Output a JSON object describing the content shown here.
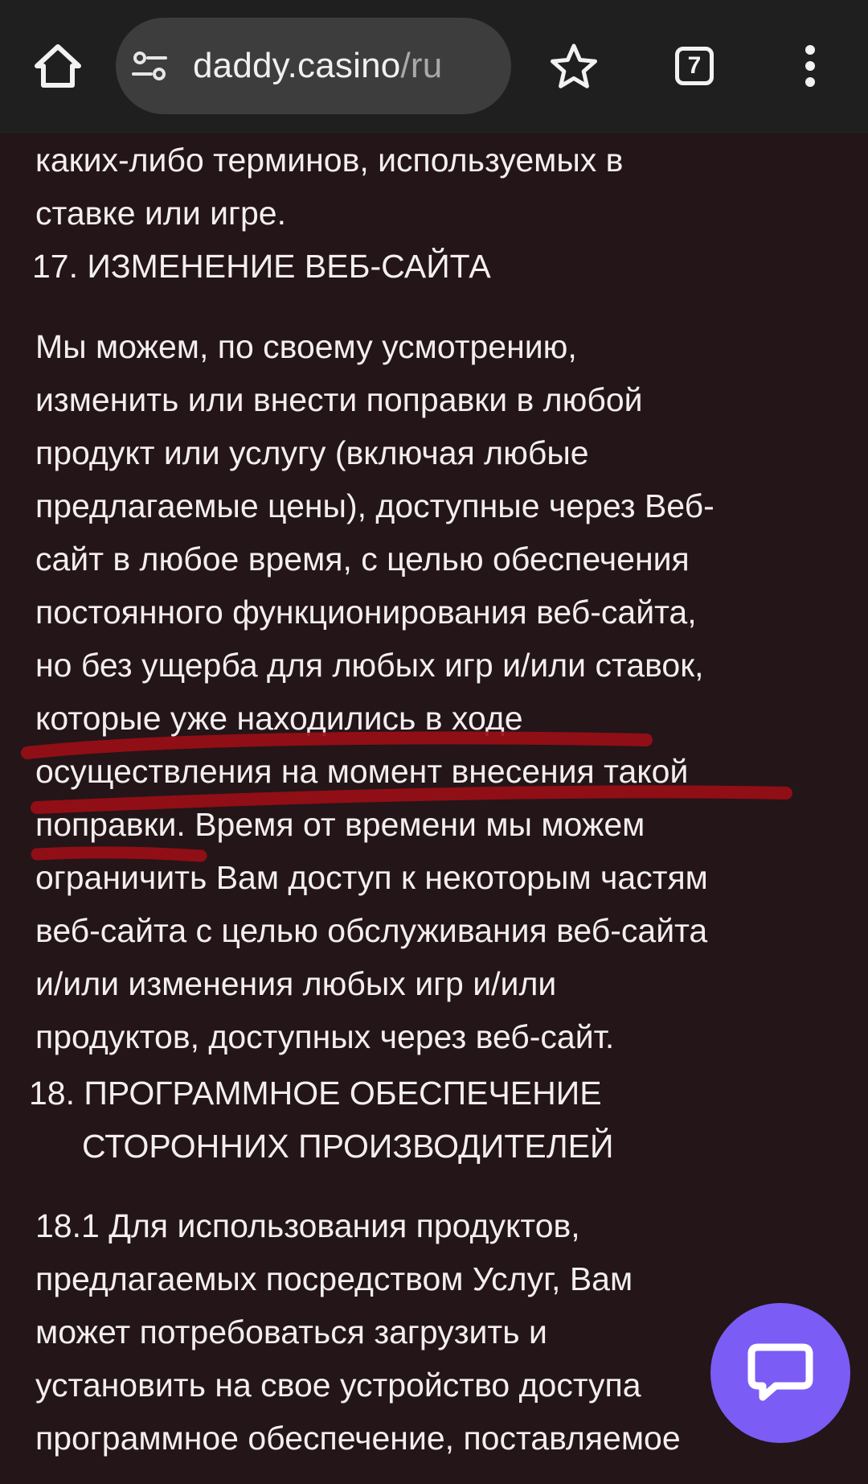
{
  "browser": {
    "url_host": "daddy.casino",
    "url_path": "/ru",
    "tab_count": "7",
    "icons": {
      "home": "home-icon",
      "site_info": "site-info-icon",
      "bookmark": "star-icon",
      "tabs": "tab-switcher-icon",
      "menu": "more-vertical-icon"
    }
  },
  "content": {
    "intro_lines": [
      "каких-либо терминов, используемых в",
      "ставке или игре."
    ],
    "section17": {
      "number": "17.",
      "title": "ИЗМЕНЕНИЕ ВЕБ-САЙТА",
      "paragraph_lines": [
        "Мы можем, по своему усмотрению,",
        "изменить или внести поправки в любой",
        "продукт или услугу (включая любые",
        "предлагаемые цены), доступные через Веб-",
        "сайт в любое время, с целью обеспечения",
        "постоянного функционирования веб-сайта,",
        "но без ущерба для любых игр и/или ставок,",
        "которые уже находились в ходе",
        "осуществления на момент внесения такой",
        "поправки. Время от времени мы можем",
        "ограничить Вам доступ к некоторым частям",
        "веб-сайта с целью обслуживания веб-сайта",
        "и/или изменения любых игр и/или",
        "продуктов, доступных через веб-сайт."
      ]
    },
    "section18": {
      "number": "18.",
      "title_line1": "ПРОГРАММНОЕ ОБЕСПЕЧЕНИЕ",
      "title_line2": "СТОРОННИХ ПРОИЗВОДИТЕЛЕЙ",
      "paragraph_lines": [
        "18.1 Для использования продуктов,",
        "предлагаемых посредством Услуг, Вам",
        "может потребоваться загрузить и",
        "установить на свое устройство доступа",
        "программное обеспечение, поставляемое"
      ]
    }
  },
  "annotation": {
    "color": "#9a0e16"
  },
  "chat": {
    "icon": "chat-bubble-icon",
    "color": "#7b5cf5"
  }
}
